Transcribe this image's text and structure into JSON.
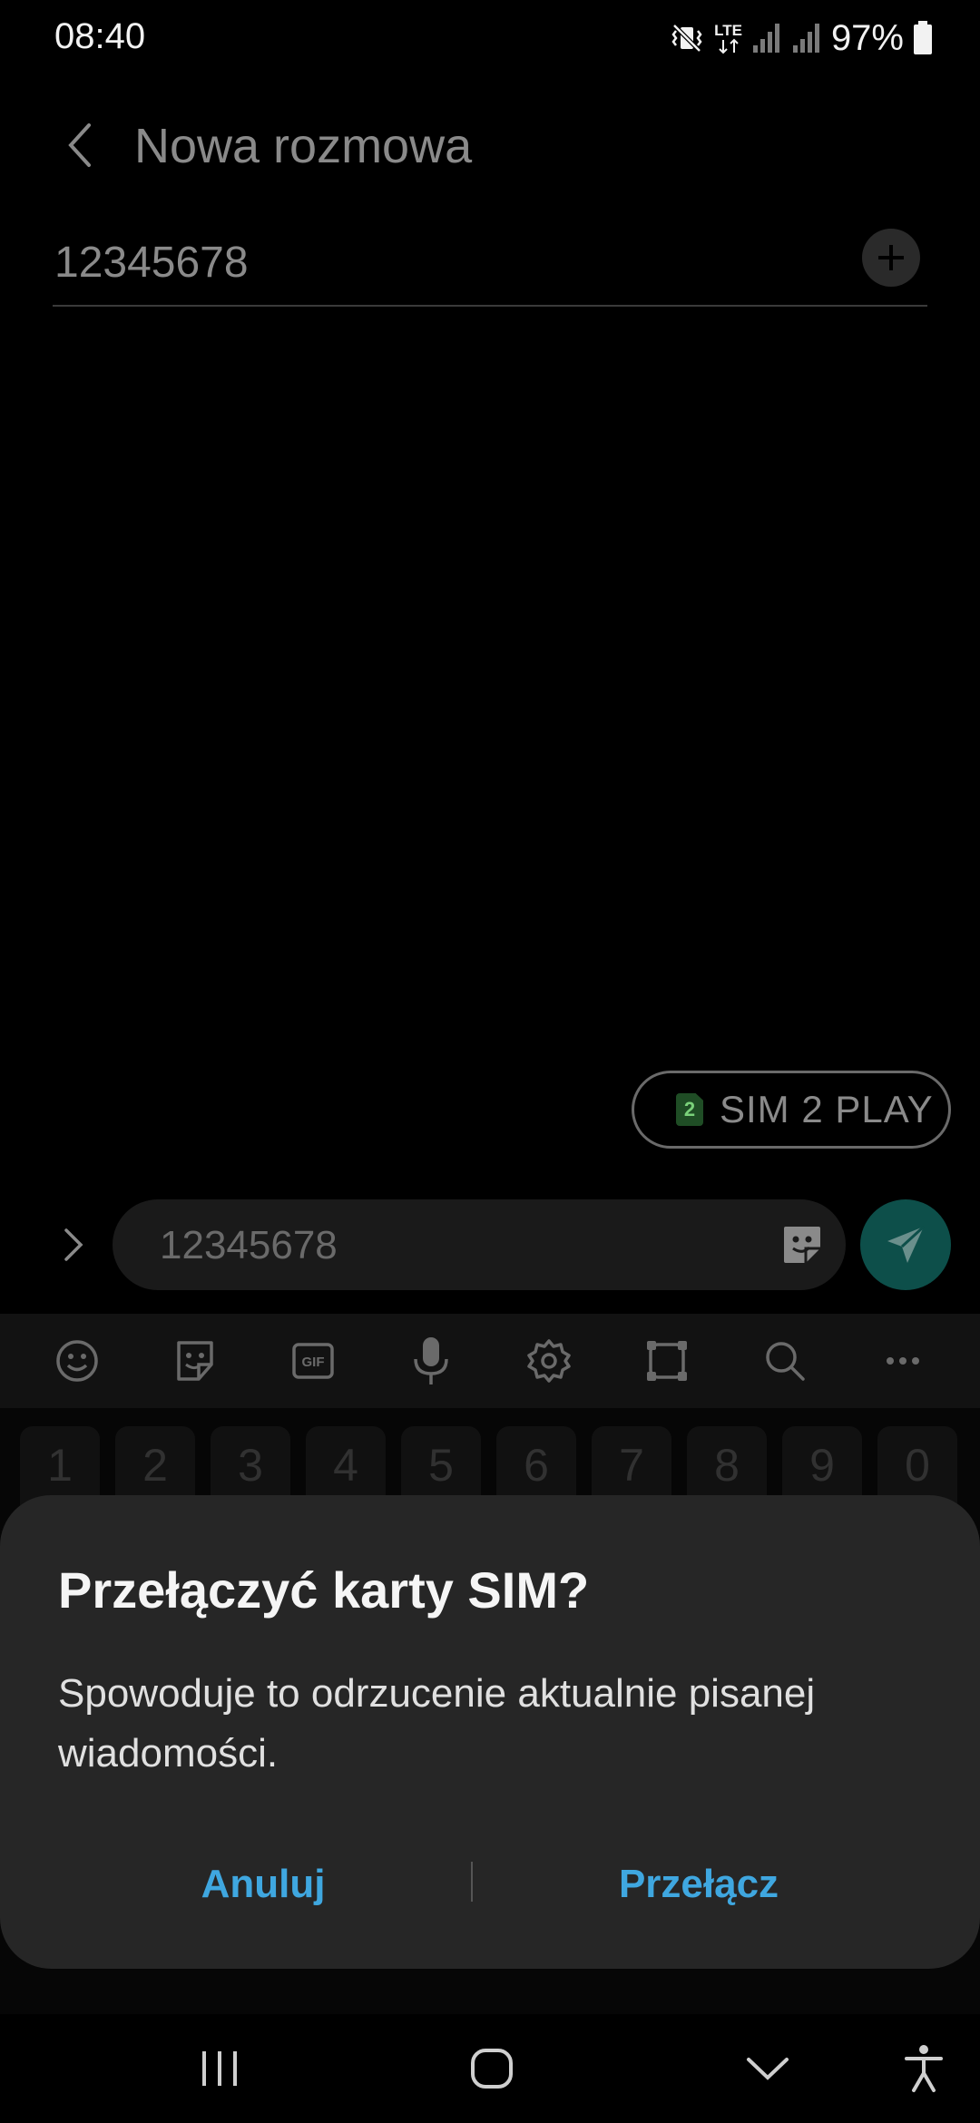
{
  "status_bar": {
    "time": "08:40",
    "network": "LTE",
    "battery": "97%"
  },
  "header": {
    "title": "Nowa rozmowa"
  },
  "recipient": {
    "value": "12345678"
  },
  "sim_chip": {
    "badge": "2",
    "label": "SIM 2 PLAY"
  },
  "compose": {
    "text": "12345678"
  },
  "keyboard": {
    "toolbar_icons": [
      "emoji-icon",
      "sticker-icon",
      "gif-icon",
      "microphone-icon",
      "settings-icon",
      "resize-icon",
      "search-icon",
      "more-icon"
    ],
    "gif_label": "GIF",
    "number_keys": [
      "1",
      "2",
      "3",
      "4",
      "5",
      "6",
      "7",
      "8",
      "9",
      "0"
    ]
  },
  "dialog": {
    "title": "Przełączyć karty SIM?",
    "message": "Spowoduje to odrzucenie aktualnie pisanej wiadomości.",
    "cancel_label": "Anuluj",
    "confirm_label": "Przełącz"
  },
  "colors": {
    "accent": "#3fa7e0",
    "send_button": "#0d4f4a",
    "dialog_bg": "#262626"
  }
}
